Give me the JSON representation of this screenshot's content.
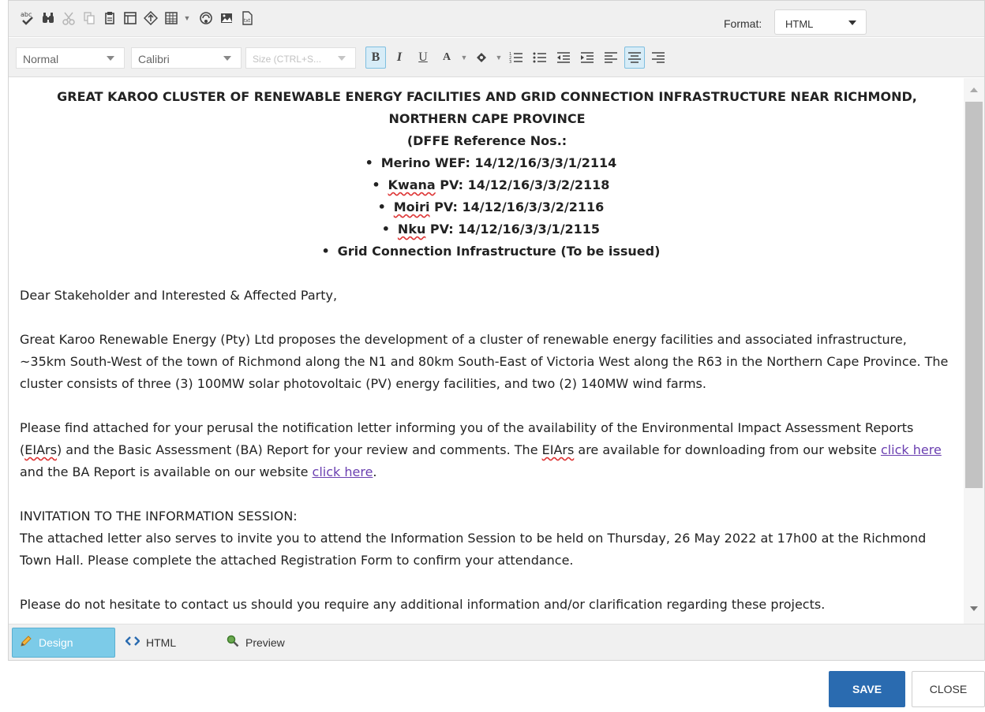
{
  "toolbar1": {
    "icons": [
      "spellcheck-icon",
      "find-icon",
      "cut-icon",
      "copy-icon",
      "paste-icon",
      "template-icon",
      "insert-symbol-icon",
      "table-icon",
      "dropdown-icon",
      "link-manager-icon",
      "image-manager-icon",
      "document-manager-icon"
    ],
    "format_label": "Format:",
    "format_value": "HTML"
  },
  "toolbar2": {
    "paragraph_style": "Normal",
    "font_name": "Calibri",
    "font_size": "Size (CTRL+S...",
    "buttons": {
      "bold": "B",
      "italic": "I",
      "underline": "U",
      "font_color": "A"
    }
  },
  "document": {
    "heading_line1": "GREAT KAROO CLUSTER OF RENEWABLE ENERGY FACILITIES AND GRID CONNECTION INFRASTRUCTURE NEAR RICHMOND,",
    "heading_line2": "NORTHERN CAPE PROVINCE",
    "heading_line3": "(DFFE Reference Nos.:",
    "refs": [
      {
        "pre": "Merino WEF:  14/12/16/3/3/1/2114",
        "wavy": "",
        "post": ""
      },
      {
        "pre": "",
        "wavy": "Kwana",
        "post": " PV: 14/12/16/3/3/2/2118"
      },
      {
        "pre": "",
        "wavy": "Moiri",
        "post": " PV: 14/12/16/3/3/2/2116"
      },
      {
        "pre": "",
        "wavy": "Nku",
        "post": " PV: 14/12/16/3/3/1/2115"
      },
      {
        "pre": "Grid Connection Infrastructure (To be issued)",
        "wavy": "",
        "post": ""
      }
    ],
    "bullet": "•",
    "greeting": "Dear Stakeholder and Interested & Affected Party,",
    "para1": "Great Karoo Renewable Energy (Pty) Ltd proposes the development of a cluster of renewable energy facilities and associated infrastructure, ~35km South-West of the town of Richmond along the N1 and 80km South-East of Victoria West along the R63 in the Northern Cape Province.  The cluster consists of three (3) 100MW solar photovoltaic (PV) energy facilities, and two (2) 140MW wind farms.",
    "para2_a": "Please find attached for your perusal the notification letter informing you of the availability of the Environmental Impact Assessment Reports (",
    "para2_eiars1": "EIArs",
    "para2_b": ") and the Basic Assessment (BA) Report for your review and comments.  The ",
    "para2_eiars2": "EIArs",
    "para2_c": " are available for downloading from our website ",
    "para2_link1": "click here",
    "para2_d": " and the BA Report is available on our website ",
    "para2_link2": "click here",
    "para2_e": ".",
    "invitation_heading": "INVITATION TO THE INFORMATION SESSION:",
    "para3": "The attached letter also serves to invite you to attend the Information Session to be held on Thursday, 26 May 2022 at 17h00 at the Richmond Town Hall.  Please complete the attached Registration Form to confirm your attendance.",
    "para4": "Please do not hesitate to contact us should you require any additional information and/or clarification regarding these projects."
  },
  "modes": {
    "design": "Design",
    "html": "HTML",
    "preview": "Preview"
  },
  "actions": {
    "save": "SAVE",
    "close": "CLOSE"
  },
  "colors": {
    "accent": "#2a6bb0",
    "active_tab": "#7ccbe8",
    "link": "#6a3fb0"
  }
}
